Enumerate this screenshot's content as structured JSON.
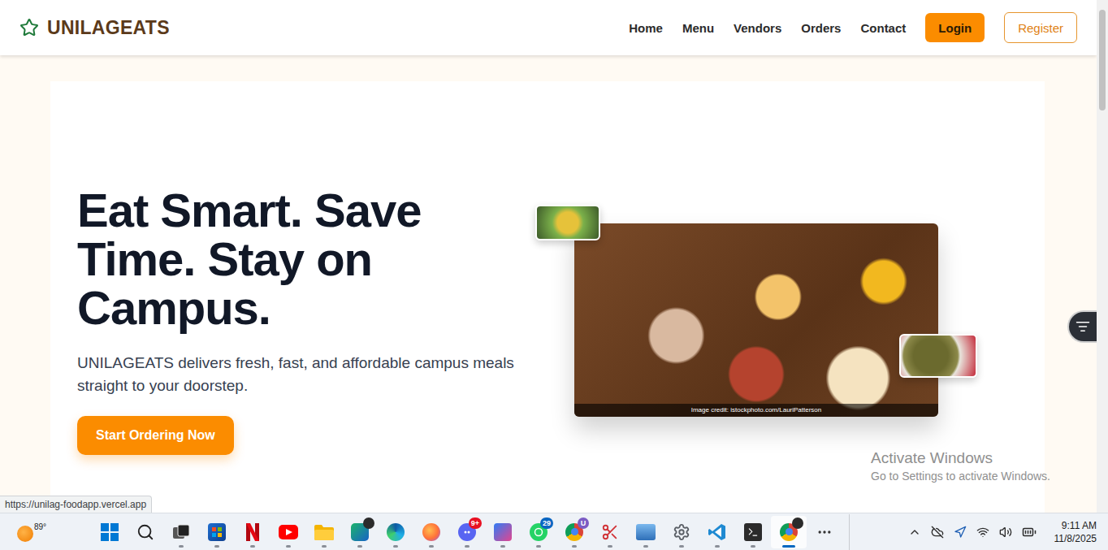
{
  "browser": {
    "status_url": "https://unilag-foodapp.vercel.app"
  },
  "header": {
    "logo": "UNILAGEATS",
    "nav": [
      {
        "label": "Home",
        "selected": false
      },
      {
        "label": "Menu",
        "selected": false
      },
      {
        "label": "Vendors",
        "selected": false
      },
      {
        "label": "Orders",
        "selected": false
      },
      {
        "label": "Contact",
        "selected": false
      }
    ],
    "login": "Login",
    "register": "Register"
  },
  "hero": {
    "title": "Eat Smart. Save Time. Stay on Campus.",
    "subtitle": "UNILAGEATS delivers fresh, fast, and affordable campus meals straight to your doorstep.",
    "cta": "Start Ordering Now",
    "image_credit": "Image credit: istockphoto.com/LauriPatterson"
  },
  "watermark": {
    "title": "Activate Windows",
    "subtitle": "Go to Settings to activate Windows."
  },
  "taskbar": {
    "weather": "89°",
    "apps": [
      {
        "running": false,
        "active": false
      },
      {
        "running": false,
        "active": false
      },
      {
        "running": true,
        "active": false
      },
      {
        "running": true,
        "active": false
      },
      {
        "running": true,
        "active": false
      },
      {
        "running": true,
        "active": false
      },
      {
        "running": true,
        "active": false
      },
      {
        "running": true,
        "active": false,
        "badge": {
          "text": "",
          "color": "#2b2b2b"
        }
      },
      {
        "running": true,
        "active": false
      },
      {
        "running": true,
        "active": false
      },
      {
        "running": true,
        "active": false,
        "badge": {
          "text": "9+",
          "color": "#e81123"
        }
      },
      {
        "running": true,
        "active": false
      },
      {
        "running": true,
        "active": false,
        "badge": {
          "text": "29",
          "color": "#0a66c2"
        }
      },
      {
        "running": true,
        "active": false,
        "badge": {
          "text": "U",
          "color": "#7b5cc4"
        }
      },
      {
        "running": true,
        "active": false
      },
      {
        "running": true,
        "active": false
      },
      {
        "running": true,
        "active": false
      },
      {
        "running": true,
        "active": false
      },
      {
        "running": true,
        "active": false
      },
      {
        "running": true,
        "active": true,
        "badge": {
          "text": "",
          "color": "#2b2b2b"
        }
      }
    ],
    "clock": {
      "time": "9:11 AM",
      "date": "11/8/2025"
    }
  }
}
